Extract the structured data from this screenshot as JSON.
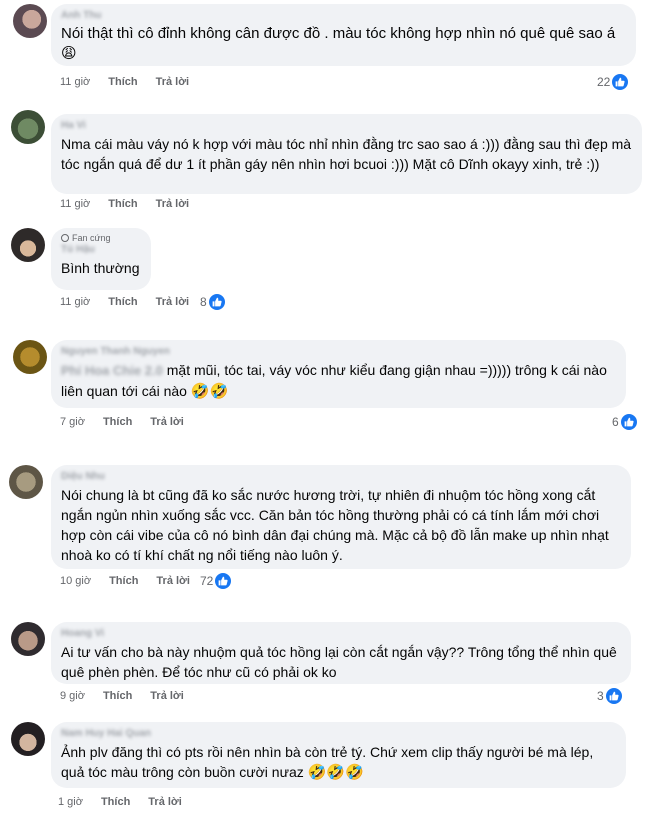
{
  "labels": {
    "like": "Thích",
    "reply": "Trả lời"
  },
  "comments": [
    {
      "author": "Anh Thu",
      "text": "Nói thật thì cô đỉnh không cân được đồ . màu tóc không hợp nhìn nó quê quê sao á",
      "emoji": "😩",
      "time": "11 giờ",
      "reactions": "22"
    },
    {
      "author": "Ha Vi",
      "text": "Nma cái màu váy nó k hợp với màu tóc nhỉ nhìn đằng trc sao sao á :))) đằng sau thì đẹp mà tóc ngắn quá để dư 1 ít phần gáy nên nhìn hơi bcuoi :))) Mặt cô Dĩnh okayy xinh, trẻ :))",
      "time": "11 giờ"
    },
    {
      "badge": "Fan cứng",
      "author": "Tú Hậu",
      "text": "Bình thường",
      "time": "11 giờ",
      "reactions": "8"
    },
    {
      "author": "Nguyen Thanh Nguyen",
      "mention": "Phí Hoa Chie 2.0",
      "text": "mặt mũi, tóc tai, váy vóc như kiểu đang giận nhau =))))) trông k cái nào liên quan tới cái nào",
      "emoji": "🤣🤣",
      "time": "7 giờ",
      "reactions": "6"
    },
    {
      "author": "Diệu Nhu",
      "text": "Nói chung là bt cũng đã ko sắc nước hương trời, tự nhiên đi nhuộm tóc hồng xong cắt ngắn ngủn nhìn xuống sắc vcc. Căn bản tóc hồng thường phải có cá tính lắm mới chơi hợp còn cái vibe của cô nó bình dân đại chúng mà. Mặc cả bộ đồ lẫn make up nhìn nhạt nhoà ko có tí khí chất ng nổi tiếng nào luôn ý.",
      "time": "10 giờ",
      "reactions": "72"
    },
    {
      "author": "Hoang Vi",
      "text": "Ai tư vấn cho bà này nhuộm quả tóc hồng lại còn cắt ngắn vậy?? Trông tổng thể nhìn quê quê phèn phèn. Để tóc như cũ có phải ok ko",
      "time": "9 giờ",
      "reactions": "3"
    },
    {
      "author": "Nam Huy Hai Quan",
      "text": "Ảnh plv đăng thì có pts rồi nên nhìn bà còn trẻ tý. Chứ xem clip thấy người bé mà lép, quả tóc màu trông còn buồn cười nưaz",
      "emoji": "🤣🤣🤣",
      "time": "1 giờ"
    }
  ]
}
